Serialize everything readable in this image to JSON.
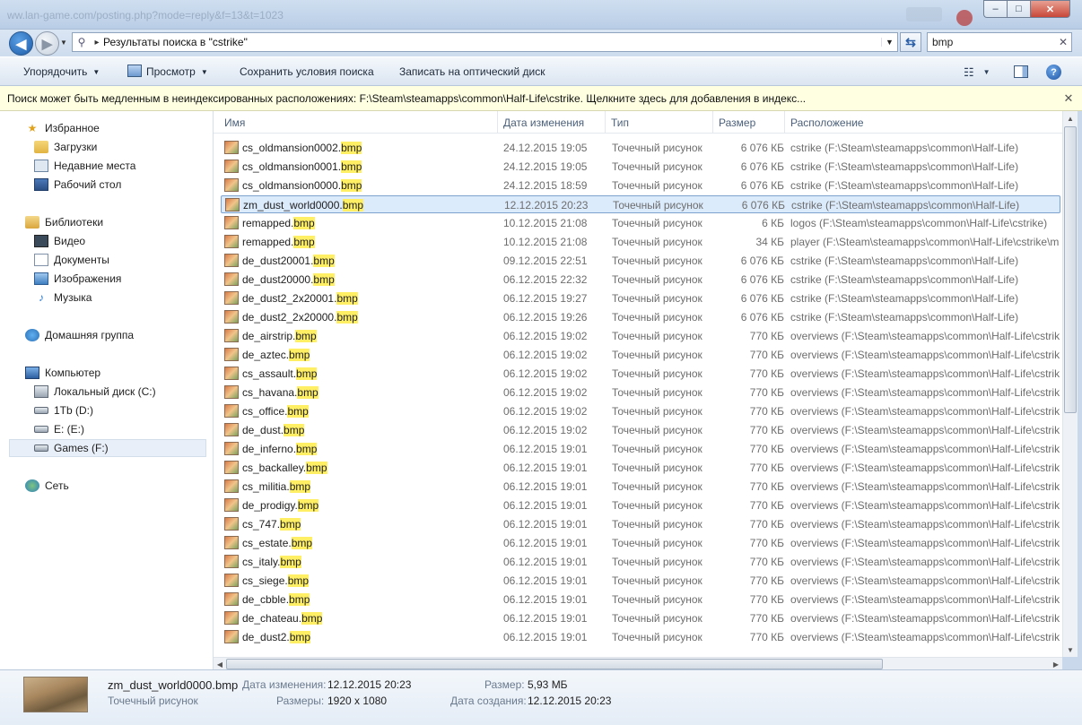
{
  "window": {
    "background_hint": "ww.lan-game.com/posting.php?mode=reply&f=13&t=1023",
    "controls": {
      "minimize": "–",
      "maximize": "□",
      "close": "✕"
    }
  },
  "nav": {
    "address": "Результаты поиска в \"cstrike\"",
    "search_value": "bmp"
  },
  "toolbar": {
    "organize": "Упорядочить",
    "view": "Просмотр",
    "save_search": "Сохранить условия поиска",
    "burn": "Записать на оптический диск"
  },
  "infobar": {
    "text": "Поиск может быть медленным в неиндексированных расположениях: F:\\Steam\\steamapps\\common\\Half-Life\\cstrike. Щелкните здесь для добавления в индекс..."
  },
  "sidebar": {
    "favorites": "Избранное",
    "downloads": "Загрузки",
    "recent": "Недавние места",
    "desktop": "Рабочий стол",
    "libraries": "Библиотеки",
    "video": "Видео",
    "documents": "Документы",
    "images": "Изображения",
    "music": "Музыка",
    "homegroup": "Домашняя группа",
    "computer": "Компьютер",
    "drive_c": "Локальный диск (C:)",
    "drive_d": "1Tb (D:)",
    "drive_e": "E: (E:)",
    "drive_f": "Games (F:)",
    "network": "Сеть"
  },
  "columns": {
    "name": "Имя",
    "date": "Дата изменения",
    "type": "Тип",
    "size": "Размер",
    "location": "Расположение"
  },
  "files": [
    {
      "base": "cs_oldmansion0002.",
      "ext": "bmp",
      "date": "24.12.2015 19:05",
      "type": "Точечный рисунок",
      "size": "6 076 КБ",
      "location": "cstrike (F:\\Steam\\steamapps\\common\\Half-Life)"
    },
    {
      "base": "cs_oldmansion0001.",
      "ext": "bmp",
      "date": "24.12.2015 19:05",
      "type": "Точечный рисунок",
      "size": "6 076 КБ",
      "location": "cstrike (F:\\Steam\\steamapps\\common\\Half-Life)"
    },
    {
      "base": "cs_oldmansion0000.",
      "ext": "bmp",
      "date": "24.12.2015 18:59",
      "type": "Точечный рисунок",
      "size": "6 076 КБ",
      "location": "cstrike (F:\\Steam\\steamapps\\common\\Half-Life)"
    },
    {
      "base": "zm_dust_world0000.",
      "ext": "bmp",
      "date": "12.12.2015 20:23",
      "type": "Точечный рисунок",
      "size": "6 076 КБ",
      "location": "cstrike (F:\\Steam\\steamapps\\common\\Half-Life)",
      "selected": true
    },
    {
      "base": "remapped.",
      "ext": "bmp",
      "date": "10.12.2015 21:08",
      "type": "Точечный рисунок",
      "size": "6 КБ",
      "location": "logos (F:\\Steam\\steamapps\\common\\Half-Life\\cstrike)"
    },
    {
      "base": "remapped.",
      "ext": "bmp",
      "date": "10.12.2015 21:08",
      "type": "Точечный рисунок",
      "size": "34 КБ",
      "location": "player (F:\\Steam\\steamapps\\common\\Half-Life\\cstrike\\m"
    },
    {
      "base": "de_dust20001.",
      "ext": "bmp",
      "date": "09.12.2015 22:51",
      "type": "Точечный рисунок",
      "size": "6 076 КБ",
      "location": "cstrike (F:\\Steam\\steamapps\\common\\Half-Life)"
    },
    {
      "base": "de_dust20000.",
      "ext": "bmp",
      "date": "06.12.2015 22:32",
      "type": "Точечный рисунок",
      "size": "6 076 КБ",
      "location": "cstrike (F:\\Steam\\steamapps\\common\\Half-Life)"
    },
    {
      "base": "de_dust2_2x20001.",
      "ext": "bmp",
      "date": "06.12.2015 19:27",
      "type": "Точечный рисунок",
      "size": "6 076 КБ",
      "location": "cstrike (F:\\Steam\\steamapps\\common\\Half-Life)"
    },
    {
      "base": "de_dust2_2x20000.",
      "ext": "bmp",
      "date": "06.12.2015 19:26",
      "type": "Точечный рисунок",
      "size": "6 076 КБ",
      "location": "cstrike (F:\\Steam\\steamapps\\common\\Half-Life)"
    },
    {
      "base": "de_airstrip.",
      "ext": "bmp",
      "date": "06.12.2015 19:02",
      "type": "Точечный рисунок",
      "size": "770 КБ",
      "location": "overviews (F:\\Steam\\steamapps\\common\\Half-Life\\cstrike"
    },
    {
      "base": "de_aztec.",
      "ext": "bmp",
      "date": "06.12.2015 19:02",
      "type": "Точечный рисунок",
      "size": "770 КБ",
      "location": "overviews (F:\\Steam\\steamapps\\common\\Half-Life\\cstrike"
    },
    {
      "base": "cs_assault.",
      "ext": "bmp",
      "date": "06.12.2015 19:02",
      "type": "Точечный рисунок",
      "size": "770 КБ",
      "location": "overviews (F:\\Steam\\steamapps\\common\\Half-Life\\cstrike"
    },
    {
      "base": "cs_havana.",
      "ext": "bmp",
      "date": "06.12.2015 19:02",
      "type": "Точечный рисунок",
      "size": "770 КБ",
      "location": "overviews (F:\\Steam\\steamapps\\common\\Half-Life\\cstrike"
    },
    {
      "base": "cs_office.",
      "ext": "bmp",
      "date": "06.12.2015 19:02",
      "type": "Точечный рисунок",
      "size": "770 КБ",
      "location": "overviews (F:\\Steam\\steamapps\\common\\Half-Life\\cstrike"
    },
    {
      "base": "de_dust.",
      "ext": "bmp",
      "date": "06.12.2015 19:02",
      "type": "Точечный рисунок",
      "size": "770 КБ",
      "location": "overviews (F:\\Steam\\steamapps\\common\\Half-Life\\cstrike"
    },
    {
      "base": "de_inferno.",
      "ext": "bmp",
      "date": "06.12.2015 19:01",
      "type": "Точечный рисунок",
      "size": "770 КБ",
      "location": "overviews (F:\\Steam\\steamapps\\common\\Half-Life\\cstrike"
    },
    {
      "base": "cs_backalley.",
      "ext": "bmp",
      "date": "06.12.2015 19:01",
      "type": "Точечный рисунок",
      "size": "770 КБ",
      "location": "overviews (F:\\Steam\\steamapps\\common\\Half-Life\\cstrike"
    },
    {
      "base": "cs_militia.",
      "ext": "bmp",
      "date": "06.12.2015 19:01",
      "type": "Точечный рисунок",
      "size": "770 КБ",
      "location": "overviews (F:\\Steam\\steamapps\\common\\Half-Life\\cstrike"
    },
    {
      "base": "de_prodigy.",
      "ext": "bmp",
      "date": "06.12.2015 19:01",
      "type": "Точечный рисунок",
      "size": "770 КБ",
      "location": "overviews (F:\\Steam\\steamapps\\common\\Half-Life\\cstrike"
    },
    {
      "base": "cs_747.",
      "ext": "bmp",
      "date": "06.12.2015 19:01",
      "type": "Точечный рисунок",
      "size": "770 КБ",
      "location": "overviews (F:\\Steam\\steamapps\\common\\Half-Life\\cstrike"
    },
    {
      "base": "cs_estate.",
      "ext": "bmp",
      "date": "06.12.2015 19:01",
      "type": "Точечный рисунок",
      "size": "770 КБ",
      "location": "overviews (F:\\Steam\\steamapps\\common\\Half-Life\\cstrike"
    },
    {
      "base": "cs_italy.",
      "ext": "bmp",
      "date": "06.12.2015 19:01",
      "type": "Точечный рисунок",
      "size": "770 КБ",
      "location": "overviews (F:\\Steam\\steamapps\\common\\Half-Life\\cstrike"
    },
    {
      "base": "cs_siege.",
      "ext": "bmp",
      "date": "06.12.2015 19:01",
      "type": "Точечный рисунок",
      "size": "770 КБ",
      "location": "overviews (F:\\Steam\\steamapps\\common\\Half-Life\\cstrike"
    },
    {
      "base": "de_cbble.",
      "ext": "bmp",
      "date": "06.12.2015 19:01",
      "type": "Точечный рисунок",
      "size": "770 КБ",
      "location": "overviews (F:\\Steam\\steamapps\\common\\Half-Life\\cstrike"
    },
    {
      "base": "de_chateau.",
      "ext": "bmp",
      "date": "06.12.2015 19:01",
      "type": "Точечный рисунок",
      "size": "770 КБ",
      "location": "overviews (F:\\Steam\\steamapps\\common\\Half-Life\\cstrike"
    },
    {
      "base": "de_dust2.",
      "ext": "bmp",
      "date": "06.12.2015 19:01",
      "type": "Точечный рисунок",
      "size": "770 КБ",
      "location": "overviews (F:\\Steam\\steamapps\\common\\Half-Life\\cstrike"
    }
  ],
  "details": {
    "filename": "zm_dust_world0000.bmp",
    "filetype": "Точечный рисунок",
    "modified_label": "Дата изменения:",
    "modified_value": "12.12.2015 20:23",
    "dims_label": "Размеры:",
    "dims_value": "1920 x 1080",
    "size_label": "Размер:",
    "size_value": "5,93 МБ",
    "created_label": "Дата создания:",
    "created_value": "12.12.2015 20:23"
  },
  "colors": {
    "highlight": "#ffef65",
    "selection": "#dcebfc",
    "infobar": "#ffffe1"
  }
}
